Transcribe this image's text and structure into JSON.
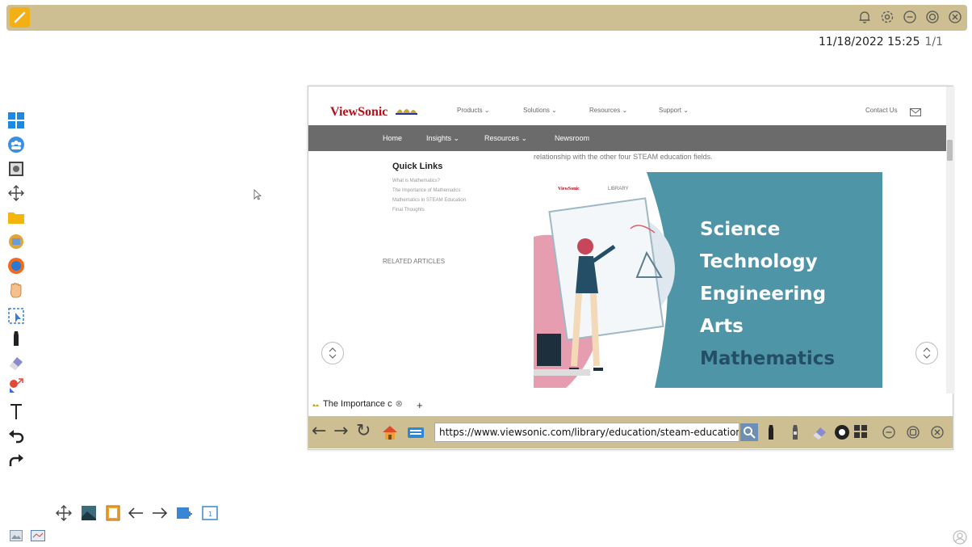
{
  "system": {
    "datetime": "11/18/2022 15:25",
    "page_indicator": "1/1"
  },
  "top_icons": [
    "bell-icon",
    "gear-icon",
    "minimize-icon",
    "record-icon",
    "close-icon"
  ],
  "left_toolbar": [
    "windows-icon",
    "people-icon",
    "camera-icon",
    "move-icon",
    "folder-icon",
    "box-icon",
    "browser-icon",
    "hand-icon",
    "select-icon",
    "marker-icon",
    "eraser-icon",
    "shapes-icon",
    "text-icon",
    "undo-icon",
    "redo-icon"
  ],
  "webpage": {
    "logo": "ViewSonic",
    "menu": {
      "products": "Products ⌄",
      "solutions": "Solutions ⌄",
      "resources": "Resources ⌄",
      "support": "Support ⌄",
      "contact": "Contact Us"
    },
    "nav": {
      "home": "Home",
      "insights": "Insights ⌄",
      "resources": "Resources ⌄",
      "newsroom": "Newsroom"
    },
    "intro_text": "relationship with the other four STEAM education fields.",
    "quick_links": {
      "title": "Quick Links",
      "items": [
        "What is Mathematics?",
        "The Importance of Mathematics",
        "Mathematics in STEAM Education",
        "Final Thoughts"
      ]
    },
    "related": "RELATED ARTICLES",
    "hero": {
      "mini_logo": "ViewSonic",
      "mini_tag": "LIBRARY",
      "words": [
        "Science",
        "Technology",
        "Engineering",
        "Arts",
        "Mathematics"
      ]
    }
  },
  "browser": {
    "tab_title": "The Importance c",
    "tab_add": "+",
    "url": "https://www.viewsonic.com/library/education/steam-education/the-importance-of-mathematics"
  },
  "colors": {
    "toolbar_bg": "#cdbf91",
    "accent": "#f3b014",
    "hero_bg": "#4f95a8",
    "nav_bg": "#6b6b6b",
    "brand_red": "#b0101b"
  }
}
